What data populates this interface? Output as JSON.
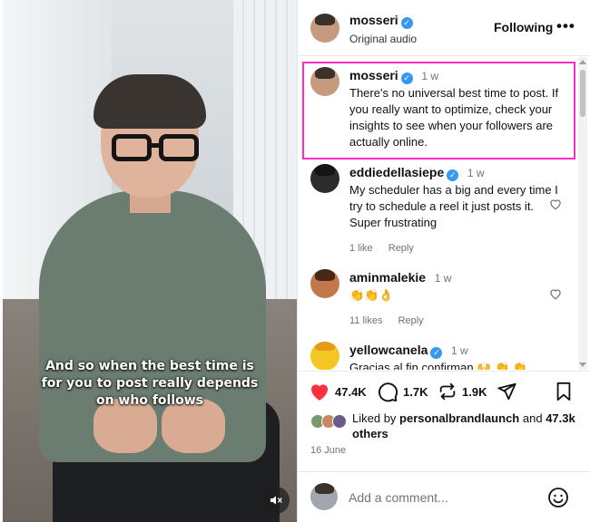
{
  "video": {
    "caption": "And so when the best time is for you to post really depends on who follows",
    "mute_icon": "speaker-muted-icon"
  },
  "header": {
    "username": "mosseri",
    "verified": true,
    "audio": "Original audio",
    "follow_label": "Following",
    "more_icon": "ellipsis-icon",
    "more_label": "•••"
  },
  "caption_comment": {
    "username": "mosseri",
    "time": "1 w",
    "text": "There's no universal best time to post. If you really want to optimize, check your insights to see when your followers are actually online."
  },
  "comments": [
    {
      "username": "eddiedellasiepe",
      "verified": true,
      "time": "1 w",
      "text": "My scheduler has a big and every time I try to schedule a reel it just posts it. Super frustrating",
      "likes": "1 like",
      "reply": "Reply"
    },
    {
      "username": "aminmalekie",
      "verified": false,
      "time": "1 w",
      "text": "👏👏👌",
      "likes": "11 likes",
      "reply": "Reply"
    },
    {
      "username": "yellowcanela",
      "verified": true,
      "time": "1 w",
      "text": "Gracias al fin confirman 🙌 👏 👏"
    }
  ],
  "actions": {
    "likes": "47.4K",
    "comments": "1.7K",
    "reposts": "1.9K"
  },
  "liked_by": {
    "prefix": "Liked by",
    "user": "personalbrandlaunch",
    "and": "and",
    "count": "47.3k",
    "suffix": "others"
  },
  "date": "16 June",
  "add_comment": {
    "placeholder": "Add a comment..."
  },
  "colors": {
    "like_red": "#ff3040",
    "verified_blue": "#3897f0",
    "highlight": "#ff2bc5"
  }
}
